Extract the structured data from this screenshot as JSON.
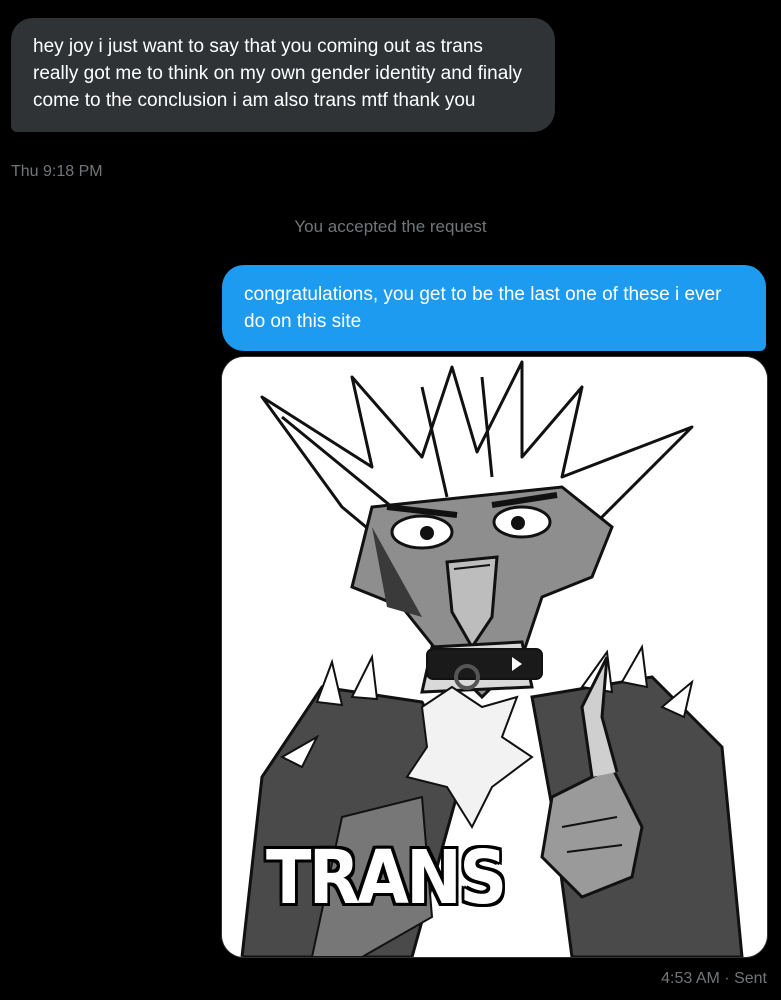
{
  "messages": {
    "incoming_text": "hey joy i just want to say that you coming out as trans really got me to think on my own gender identity and finaly come to the conclusion i am also trans mtf thank you",
    "incoming_time": "Thu 9:18 PM",
    "system_text": "You accepted the request",
    "outgoing_text": "congratulations, you get to be the last one of these i ever do on this site",
    "image_caption": "TRANS",
    "outgoing_time": "4:53 AM · Sent"
  },
  "colors": {
    "background": "#000000",
    "incoming_bubble": "#2f3336",
    "outgoing_bubble": "#1d9bf0",
    "muted_text": "#71767b"
  }
}
